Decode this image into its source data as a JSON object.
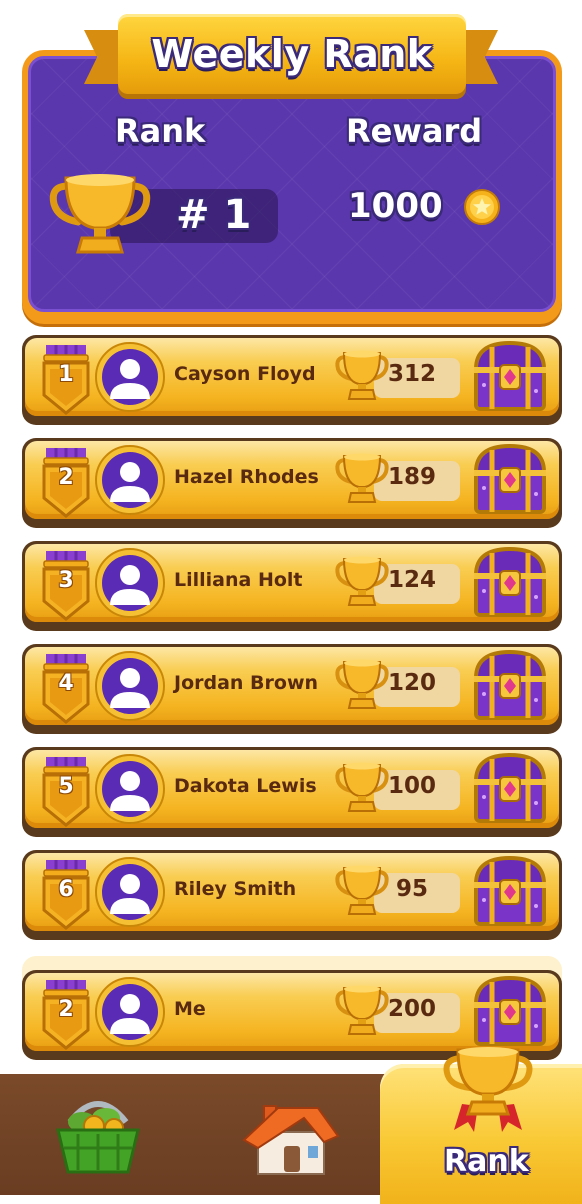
{
  "header": {
    "title": "Weekly Rank",
    "rank_label": "Rank",
    "reward_label": "Reward",
    "rank_value": "# 1",
    "reward_amount": "1000"
  },
  "rows": [
    {
      "rank": "1",
      "name": "Cayson Floyd",
      "score": "312"
    },
    {
      "rank": "2",
      "name": "Hazel Rhodes",
      "score": "189"
    },
    {
      "rank": "3",
      "name": "Lilliana Holt",
      "score": "124"
    },
    {
      "rank": "4",
      "name": "Jordan Brown",
      "score": "120"
    },
    {
      "rank": "5",
      "name": "Dakota Lewis",
      "score": "100"
    },
    {
      "rank": "6",
      "name": "Riley Smith",
      "score": "95"
    }
  ],
  "me": {
    "rank": "2",
    "name": "Me",
    "score": "200"
  },
  "nav": {
    "items": [
      {
        "icon": "shop-basket-icon"
      },
      {
        "icon": "home-house-icon"
      },
      {
        "icon": "trophy-icon",
        "label": "Rank",
        "active": true
      }
    ]
  },
  "colors": {
    "panel_purple": "#5b37ad",
    "banner_gold": "#f5b514",
    "row_gold": "#f9cd52",
    "name_brown": "#5a2a10",
    "nav_brown": "#7a4a2a"
  }
}
